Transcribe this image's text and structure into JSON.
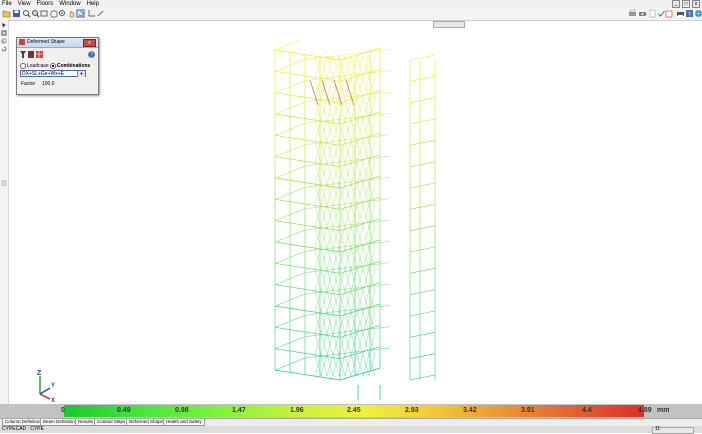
{
  "menu": [
    "File",
    "View",
    "Floors",
    "Window",
    "Help"
  ],
  "panel": {
    "title": "Deformed Shape",
    "radio_loadcase": "Loadcase",
    "radio_combinations": "Combinations",
    "combo_value": "DX+SL+Ge+Wx+E",
    "factor_label": "Factor",
    "factor_value": "100.0"
  },
  "legend": {
    "values": [
      "0",
      "0.49",
      "0.98",
      "1.47",
      "1.96",
      "2.45",
      "2.93",
      "3.42",
      "3.91",
      "4.4",
      "4.89"
    ],
    "unit": "mm"
  },
  "tabs": [
    "Column Definition",
    "Beam Definition",
    "Results",
    "Contour Maps",
    "Deformed Shape",
    "Health and Safety"
  ],
  "status": {
    "text": "CYPECAD : CYPE",
    "right": "11"
  },
  "colors": {
    "low": "#19c82c",
    "mid": "#f0f03b",
    "high": "#dd2d2a",
    "bar_bg": "#c2c2c2"
  },
  "axes": {
    "z": "Z",
    "y": "Y",
    "x": "X"
  }
}
